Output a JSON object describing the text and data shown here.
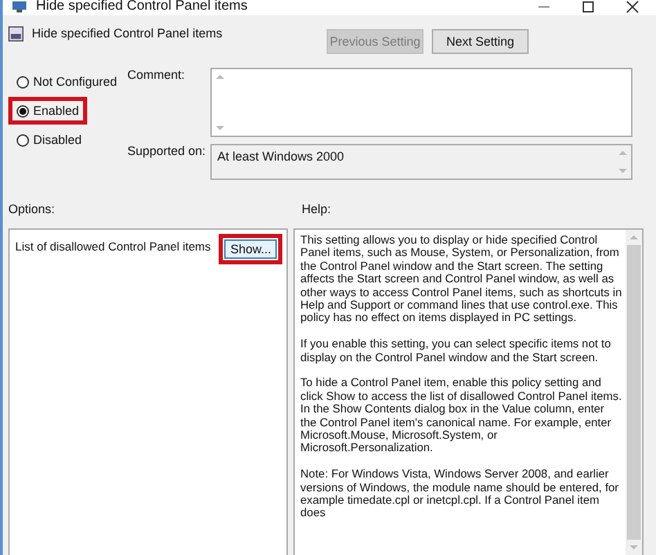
{
  "window": {
    "title": "Hide specified Control Panel items"
  },
  "header": {
    "title": "Hide specified Control Panel items",
    "buttons": [
      {
        "label": "Previous Setting",
        "disabled": true
      },
      {
        "label": "Next Setting",
        "disabled": false
      }
    ]
  },
  "state_options": [
    {
      "label": "Not Configured",
      "selected": false,
      "highlighted": false
    },
    {
      "label": "Enabled",
      "selected": true,
      "highlighted": true
    },
    {
      "label": "Disabled",
      "selected": false,
      "highlighted": false
    }
  ],
  "comment": {
    "label": "Comment:"
  },
  "supported_on": {
    "label": "Supported on:",
    "value": "At least Windows 2000"
  },
  "options": {
    "label": "Options:",
    "item": "List of disallowed Control Panel items",
    "button": "Show...",
    "button_highlighted": true
  },
  "help": {
    "label": "Help:",
    "paragraphs": [
      "This setting allows you to display or hide specified Control Panel items, such as Mouse, System, or Personalization, from the Control Panel window and the Start screen. The setting affects the Start screen and Control Panel window, as well as other ways to access Control Panel items, such as shortcuts in Help and Support or command lines that use control.exe. This policy has no effect on items displayed in PC settings.",
      "If you enable this setting, you can select specific items not to display on the Control Panel window and the Start screen.",
      "To hide a Control Panel item, enable this policy setting and click Show to access the list of disallowed Control Panel items. In the Show Contents dialog box in the Value column, enter the Control Panel item's canonical name. For example, enter Microsoft.Mouse, Microsoft.System, or Microsoft.Personalization.",
      "Note: For Windows Vista, Windows Server 2008, and earlier versions of Windows, the module name should be entered, for example timedate.cpl or inetcpl.cpl. If a Control Panel item does"
    ]
  }
}
